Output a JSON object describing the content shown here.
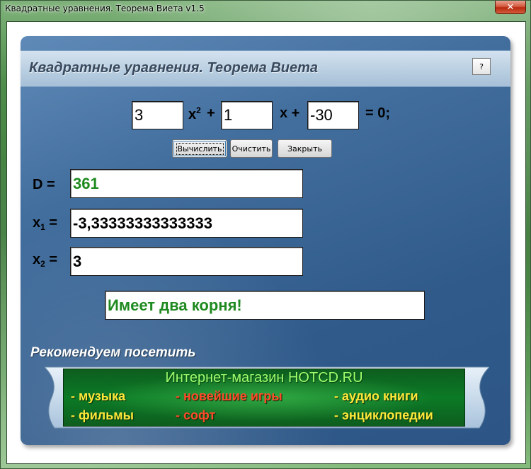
{
  "window": {
    "title": "Квадратные уравнения. Теорема Виета v1.5",
    "close_glyph": "✕"
  },
  "header": {
    "title": "Квадратные уравнения. Теорема Виета",
    "help_label": "?"
  },
  "equation": {
    "a_value": "3",
    "b_value": "1",
    "c_value": "-30",
    "x_label": "x",
    "x_sup": "2",
    "plus1": "+",
    "x2_label": "x +",
    "eq_zero": "= 0;"
  },
  "buttons": {
    "calculate": "Вычислить",
    "clear": "Очистить",
    "close": "Закрыть"
  },
  "results": {
    "d_label": "D =",
    "d_value": "361",
    "x1_label_main": "x",
    "x1_label_sub": "1",
    "x1_label_eq": "=",
    "x1_value": "-3,33333333333333",
    "x2_label_main": "x",
    "x2_label_sub": "2",
    "x2_label_eq": "=",
    "x2_value": "3",
    "status": "Имеет два корня!"
  },
  "promo": {
    "section_title": "Рекомендуем посетить",
    "banner_title": "Интернет-магазин HOTCD.RU",
    "items": {
      "music": "- музыка",
      "games": "- новейшие игры",
      "audiobooks": "- аудио книги",
      "films": "- фильмы",
      "software": "- софт",
      "encyclopedias": "- энциклопедии"
    }
  },
  "colors": {
    "panel_blue": "#436f9f",
    "result_green": "#1f8a1f",
    "banner_green": "#0b7a26",
    "promo_yellow": "#ffe83a",
    "promo_red": "#ff4a2a"
  }
}
